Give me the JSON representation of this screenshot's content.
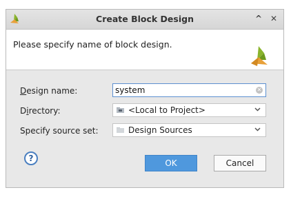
{
  "dialog": {
    "title": "Create Block Design",
    "maximize_glyph": "^",
    "close_glyph": "✕",
    "header_message": "Please specify name of block design."
  },
  "form": {
    "design_name": {
      "label_mnemonic": "D",
      "label_rest": "esign name:",
      "value": "system"
    },
    "directory": {
      "label_pre": "D",
      "label_mnemonic": "i",
      "label_rest": "rectory:",
      "value": "<Local to Project>",
      "icon": "local-folder-icon"
    },
    "source_set": {
      "label": "Specify source set:",
      "value": "Design Sources",
      "icon": "folder-icon"
    }
  },
  "buttons": {
    "help": "?",
    "ok": "OK",
    "cancel": "Cancel"
  },
  "colors": {
    "accent": "#4f98dd",
    "logo_green": "#8ab42c",
    "logo_orange": "#e8a13a"
  }
}
